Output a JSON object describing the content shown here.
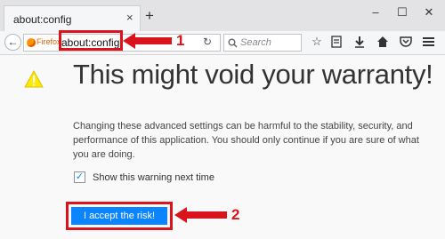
{
  "tab": {
    "title": "about:config",
    "close": "×",
    "new_tab": "+"
  },
  "window_controls": {
    "minimize": "–",
    "maximize": "☐",
    "close": "✕"
  },
  "navbar": {
    "back": "←",
    "identity_label": "Firefox",
    "url": "about:config",
    "reload": "↻",
    "search_placeholder": "Search"
  },
  "toolbar_icons": [
    "star-icon",
    "reading-list-icon",
    "download-icon",
    "home-icon",
    "pocket-icon",
    "menu-icon"
  ],
  "annotations": {
    "step1": "1",
    "step2": "2",
    "color": "#d9141c"
  },
  "content": {
    "heading": "This might void your warranty!",
    "paragraph": "Changing these advanced settings can be harmful to the stability, security, and performance of this application. You should only continue if you are sure of what you are doing.",
    "checkbox_label": "Show this warning next time",
    "checkbox_checked": true,
    "accept_button": "I accept the risk!"
  },
  "colors": {
    "accent": "#0a84ff",
    "warning": "#ffe900"
  }
}
